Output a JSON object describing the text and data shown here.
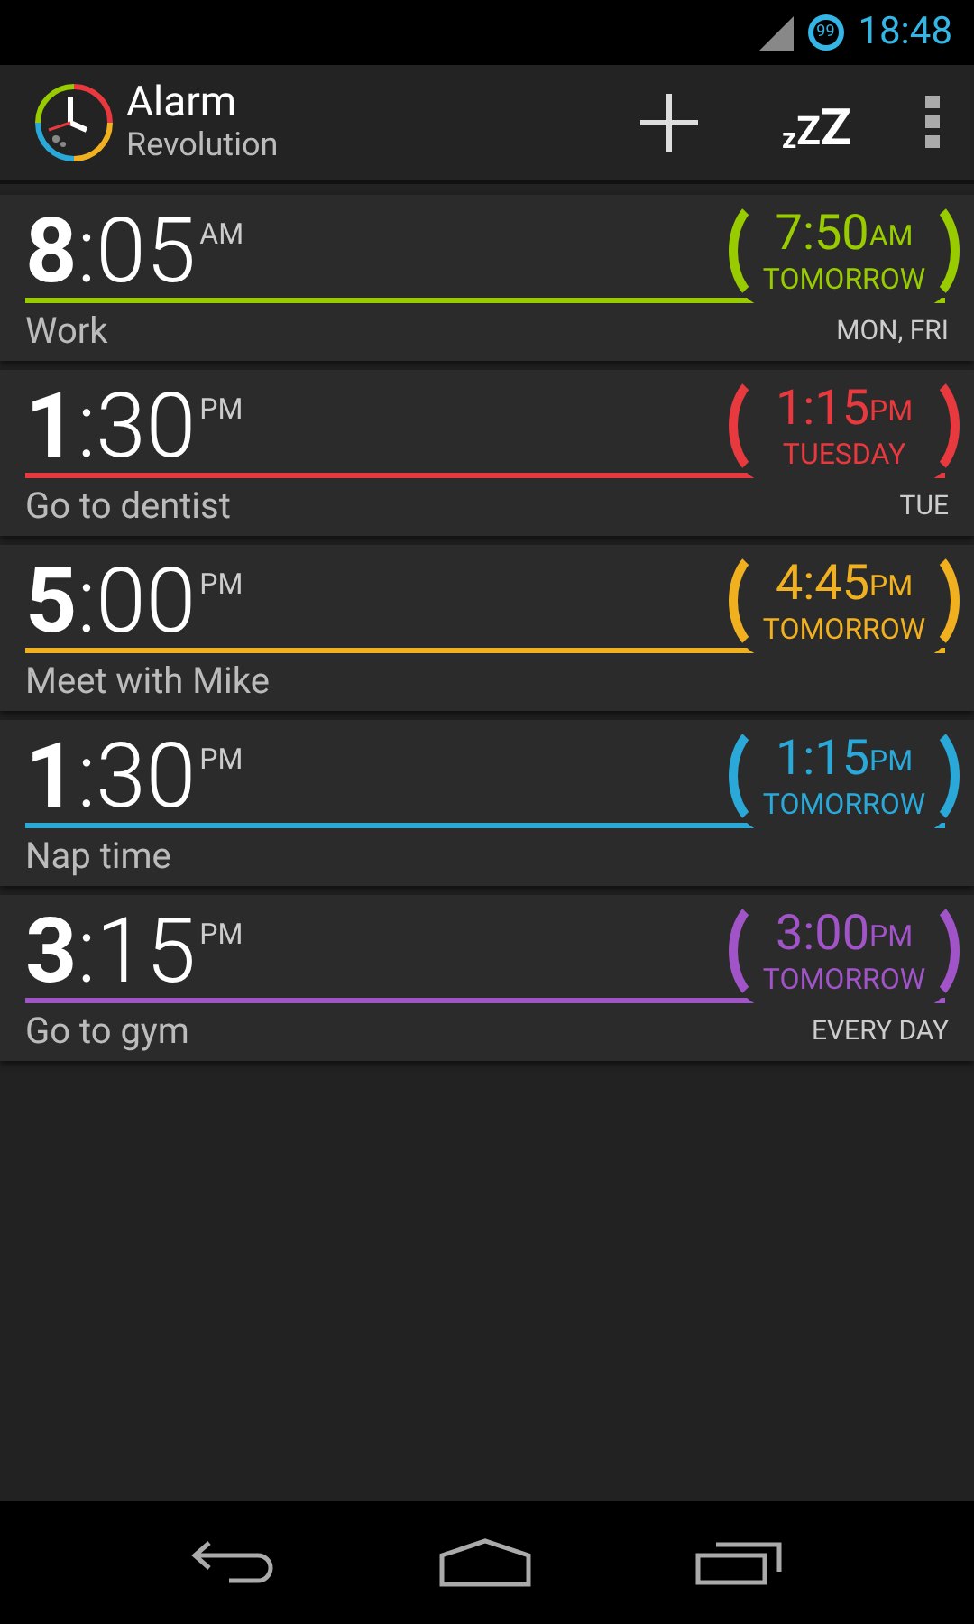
{
  "status_bar": {
    "notification_count": "99",
    "time": "18:48"
  },
  "action_bar": {
    "title": "Alarm",
    "subtitle": "Revolution",
    "snooze_label": "zZZ"
  },
  "alarms": [
    {
      "hour": "8",
      "minutes": ":05",
      "ampm": "AM",
      "label": "Work",
      "days": "MON, FRI",
      "next_time": "7:50",
      "next_ampm": "AM",
      "next_when": "TOMORROW",
      "color": "#99cc00"
    },
    {
      "hour": "1",
      "minutes": ":30",
      "ampm": "PM",
      "label": "Go to dentist",
      "days": "TUE",
      "next_time": "1:15",
      "next_ampm": "PM",
      "next_when": "TUESDAY",
      "color": "#e8393e"
    },
    {
      "hour": "5",
      "minutes": ":00",
      "ampm": "PM",
      "label": "Meet with Mike",
      "next_time": "4:45",
      "next_ampm": "PM",
      "next_when": "TOMORROW",
      "color": "#f0b020"
    },
    {
      "hour": "1",
      "minutes": ":30",
      "ampm": "PM",
      "label": "Nap time",
      "next_time": "1:15",
      "next_ampm": "PM",
      "next_when": "TOMORROW",
      "color": "#2aa8d8"
    },
    {
      "hour": "3",
      "minutes": ":15",
      "ampm": "PM",
      "label": "Go to gym",
      "days": "EVERY DAY",
      "next_time": "3:00",
      "next_ampm": "PM",
      "next_when": "TOMORROW",
      "color": "#a054c8"
    }
  ]
}
